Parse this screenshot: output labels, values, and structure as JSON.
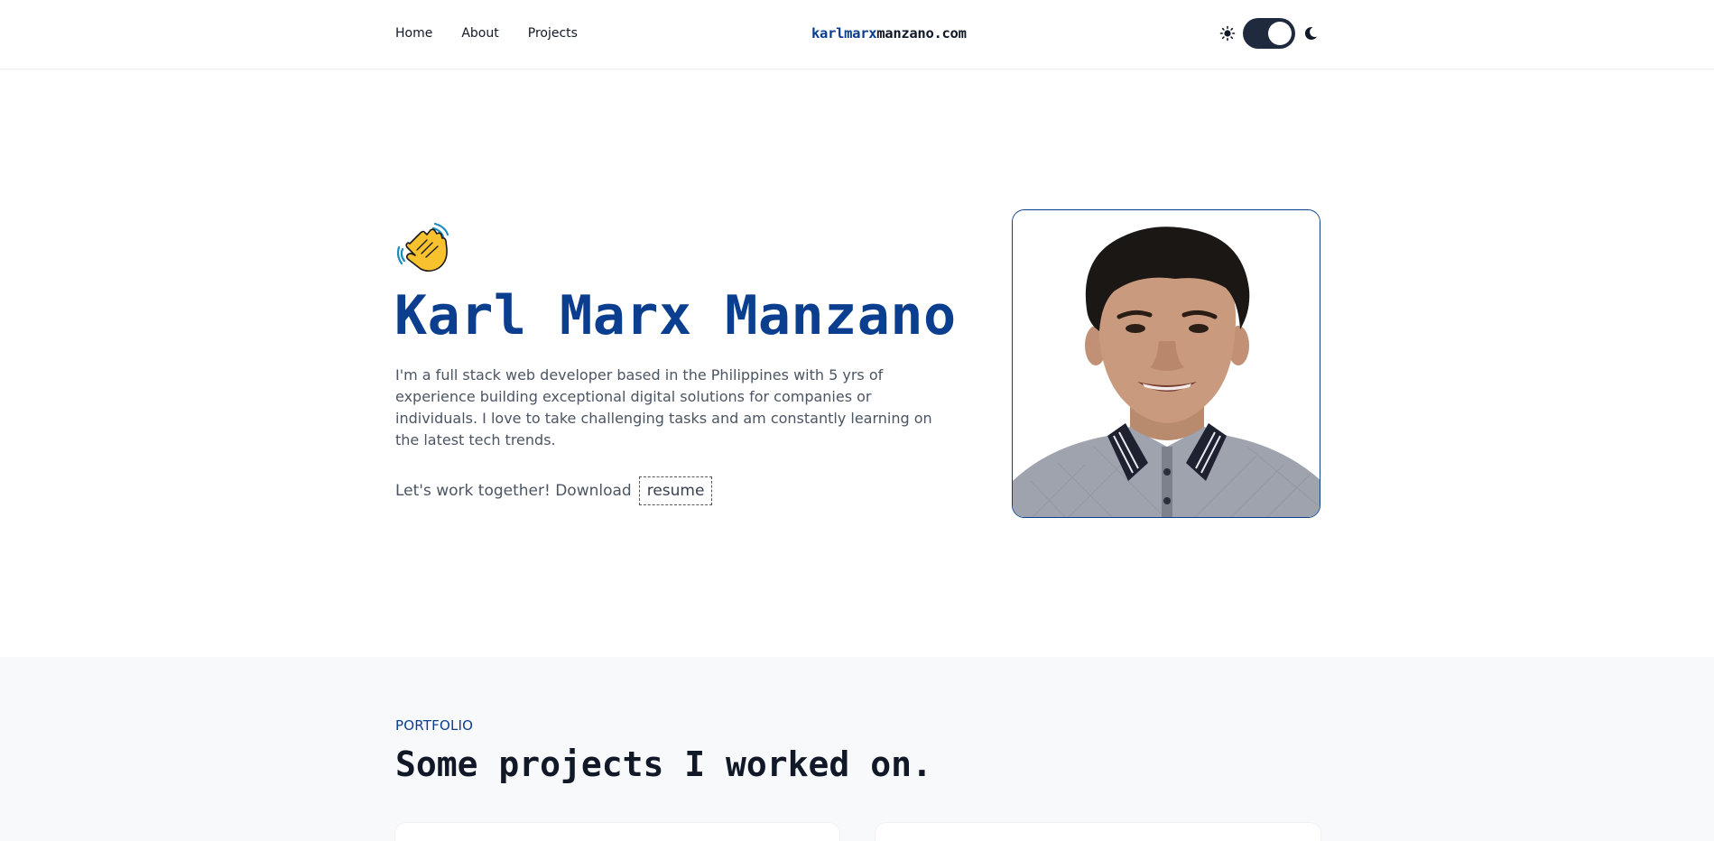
{
  "header": {
    "nav": [
      {
        "label": "Home"
      },
      {
        "label": "About"
      },
      {
        "label": "Projects"
      }
    ],
    "logo": {
      "part1": "karlmarx",
      "part2": "manzano.com"
    },
    "theme_toggle": {
      "light_icon": "sun-icon",
      "dark_icon": "moon-icon",
      "state": "dark"
    }
  },
  "hero": {
    "wave_icon": "waving-hand-icon",
    "name": "Karl Marx Manzano",
    "bio": "I'm a full stack web developer based in the Philippines with 5 yrs of experience building exceptional digital solutions for companies or individuals. I love to take challenging tasks and am constantly learning on the latest tech trends.",
    "cta_text": "Let's work together! Download",
    "resume_label": "resume",
    "photo_alt": "Karl Marx Manzano"
  },
  "portfolio": {
    "kicker": "PORTFOLIO",
    "title": "Some projects I worked on."
  },
  "colors": {
    "accent": "#0b3e8e",
    "toggle_bg": "#1f2a3f",
    "section_bg": "#f8f9fb"
  }
}
